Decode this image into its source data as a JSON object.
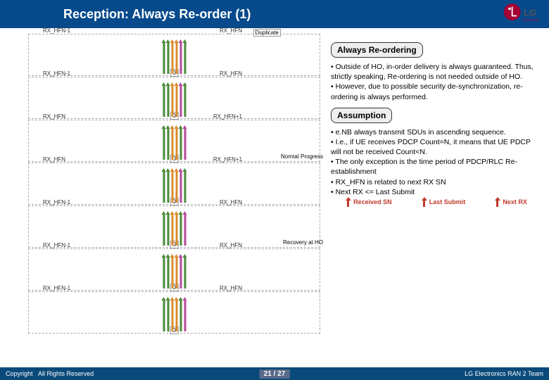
{
  "header": {
    "title": "Reception: Always Re-order (1)"
  },
  "rows": [
    {
      "left": "RX_HFN-1",
      "right": "RX_HFN",
      "dup": "Duplicate",
      "arrows": [
        "g",
        "g",
        "o",
        "o",
        "p",
        "g"
      ]
    },
    {
      "left": "RX_HFN-1",
      "right": "RX_HFN",
      "arrows": [
        "g",
        "g",
        "o",
        "o",
        "p",
        "g"
      ]
    },
    {
      "left": "RX_HFN",
      "right": "RX_HFN+1",
      "note": "Normal Progress",
      "arrows": [
        "g",
        "g",
        "o",
        "o",
        "g",
        "p"
      ]
    },
    {
      "left": "RX_HFN",
      "right": "RX_HFN+1",
      "arrows": [
        "g",
        "g",
        "o",
        "o",
        "p",
        "g"
      ]
    },
    {
      "left": "RX_HFN-1",
      "right": "RX_HFN",
      "note": "Recovery at HO",
      "arrows": [
        "g",
        "g",
        "o",
        "o",
        "g",
        "p"
      ]
    },
    {
      "left": "RX_HFN-1",
      "right": "RX_HFN",
      "arrows": [
        "g",
        "g",
        "o",
        "o",
        "p",
        "g"
      ]
    },
    {
      "left": "RX_HFN-1",
      "right": "RX_HFN",
      "arrows": [
        "g",
        "g",
        "o",
        "o",
        "g",
        "p"
      ]
    }
  ],
  "right": {
    "h1": "Always Re-ordering",
    "b1": "• Outside of HO, in-order delivery is always guaranteed. Thus, strictly speaking, Re-ordering is not needed outside of HO.\n• However, due to possible security de-synchronization, re-ordering is always performed.",
    "h2": "Assumption",
    "b2": "• e.NB always transmit SDUs in ascending sequence.\n  • I.e., if UE receives PDCP Count=N, it means that UE PDCP will not be received Count<N.\n  • The only exception is the time period of PDCP/RLC Re-establishment\n• RX_HFN is related to next RX SN\n• Next RX <= Last Submit"
  },
  "legend": {
    "a": "Received SN",
    "b": "Last Submit",
    "c": "Next RX"
  },
  "footer": {
    "copyright": "Copyright",
    "rights": "All Rights Reserved",
    "page": "21 / 27",
    "team": "LG Electronics RAN 2 Team"
  }
}
